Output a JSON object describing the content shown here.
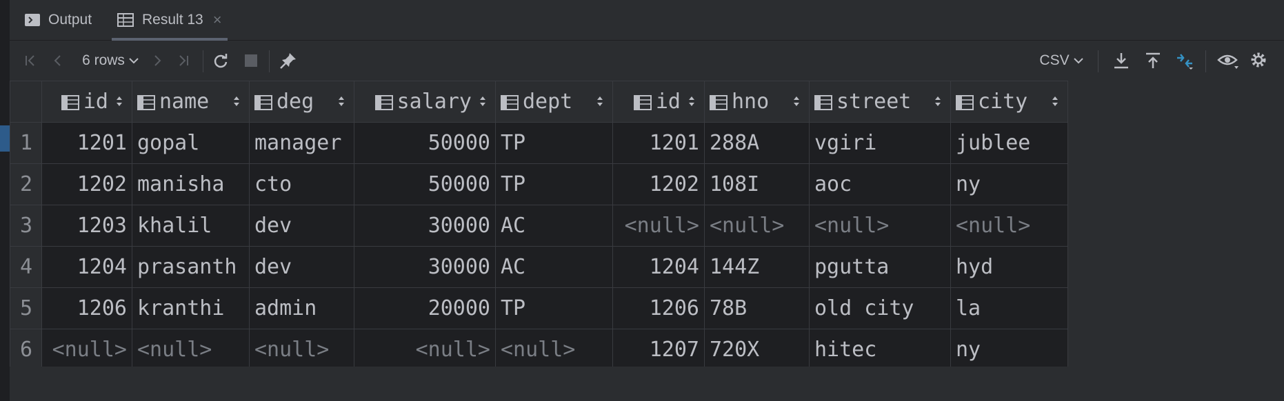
{
  "tabs": [
    {
      "label": "Output",
      "icon": "console-icon"
    },
    {
      "label": "Result 13",
      "icon": "table-icon",
      "close": "×"
    }
  ],
  "toolbar": {
    "rows_label": "6 rows",
    "format_label": "CSV"
  },
  "columns": [
    "id",
    "name",
    "deg",
    "salary",
    "dept",
    "id",
    "hno",
    "street",
    "city"
  ],
  "rows": [
    {
      "num": "1",
      "cells": [
        "1201",
        "gopal",
        "manager",
        "50000",
        "TP",
        "1201",
        "288A",
        "vgiri",
        "jublee"
      ]
    },
    {
      "num": "2",
      "cells": [
        "1202",
        "manisha",
        "cto",
        "50000",
        "TP",
        "1202",
        "108I",
        "aoc",
        "ny"
      ]
    },
    {
      "num": "3",
      "cells": [
        "1203",
        "khalil",
        "dev",
        "30000",
        "AC",
        "<null>",
        "<null>",
        "<null>",
        "<null>"
      ]
    },
    {
      "num": "4",
      "cells": [
        "1204",
        "prasanth",
        "dev",
        "30000",
        "AC",
        "1204",
        "144Z",
        "pgutta",
        "hyd"
      ]
    },
    {
      "num": "5",
      "cells": [
        "1206",
        "kranthi",
        "admin",
        "20000",
        "TP",
        "1206",
        "78B",
        "old city",
        "la"
      ]
    },
    {
      "num": "6",
      "cells": [
        "<null>",
        "<null>",
        "<null>",
        "<null>",
        "<null>",
        "1207",
        "720X",
        "hitec",
        "ny"
      ]
    }
  ],
  "colors": {
    "background": "#2b2d30",
    "grid": "#1e1f22",
    "accent": "#3592c4"
  }
}
